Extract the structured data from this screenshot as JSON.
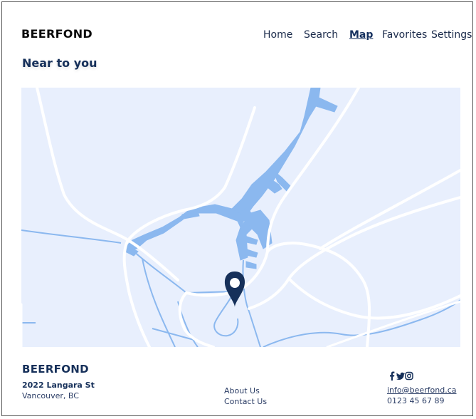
{
  "header": {
    "logo": "BEERFOND",
    "nav": [
      {
        "label": "Home"
      },
      {
        "label": "Search"
      },
      {
        "label": "Map",
        "active": true
      },
      {
        "label": "Favorites"
      },
      {
        "label": "Settings"
      }
    ]
  },
  "main": {
    "section_title": "Near to you",
    "map": {
      "marker_icon": "location-pin-icon",
      "colors": {
        "background": "#e8effd",
        "water": "#8bb8ef",
        "roads": "#ffffff",
        "marker": "#16305a"
      }
    }
  },
  "footer": {
    "logo": "BEERFOND",
    "address_line1": "2022 Langara St",
    "address_line2": "Vancouver, BC",
    "links": [
      {
        "label": "About Us"
      },
      {
        "label": "Contact Us"
      }
    ],
    "social_icons": [
      "facebook-icon",
      "twitter-icon",
      "instagram-icon"
    ],
    "email": "info@beerfond.ca",
    "phone": "0123 45 67 89"
  }
}
